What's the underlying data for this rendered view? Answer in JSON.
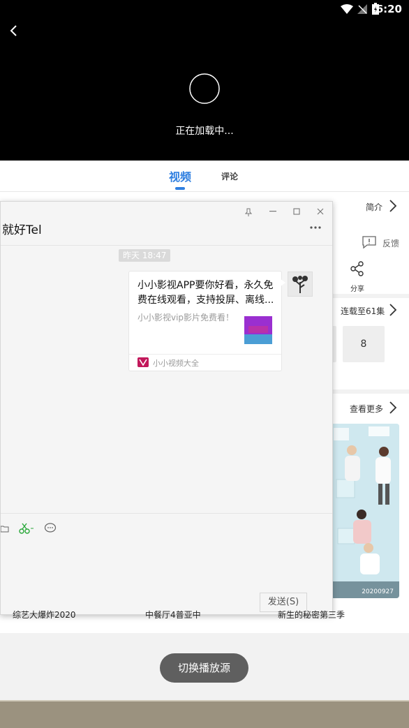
{
  "status_bar": {
    "time": "6:20"
  },
  "player": {
    "loading_text": "正在加载中..."
  },
  "tabs": [
    {
      "label": "视频"
    },
    {
      "label": "评论"
    }
  ],
  "detail": {
    "intro_label": "简介",
    "feedback_label": "反馈",
    "share_label": "分享",
    "series_status": "连载至61集",
    "episode_visible": "8",
    "more_label": "查看更多",
    "poster_date": "20200927"
  },
  "chat": {
    "title": "就好Tel",
    "time": "昨天 18:47",
    "message": {
      "title": "小小影视APP要你好看，永久免费在线观看，支持投屏、离线...",
      "description": "小小影视vip影片免费看！",
      "source": "小小视频大全"
    },
    "send_label": "发送(S)"
  },
  "bottom_titles": [
    "综艺大爆炸2020",
    "中餐厅4普亚中",
    "新生的秘密第三季"
  ],
  "switch_source_label": "切换播放源",
  "colors": {
    "accent": "#2f7fe0",
    "scissors": "#2aa83a"
  }
}
